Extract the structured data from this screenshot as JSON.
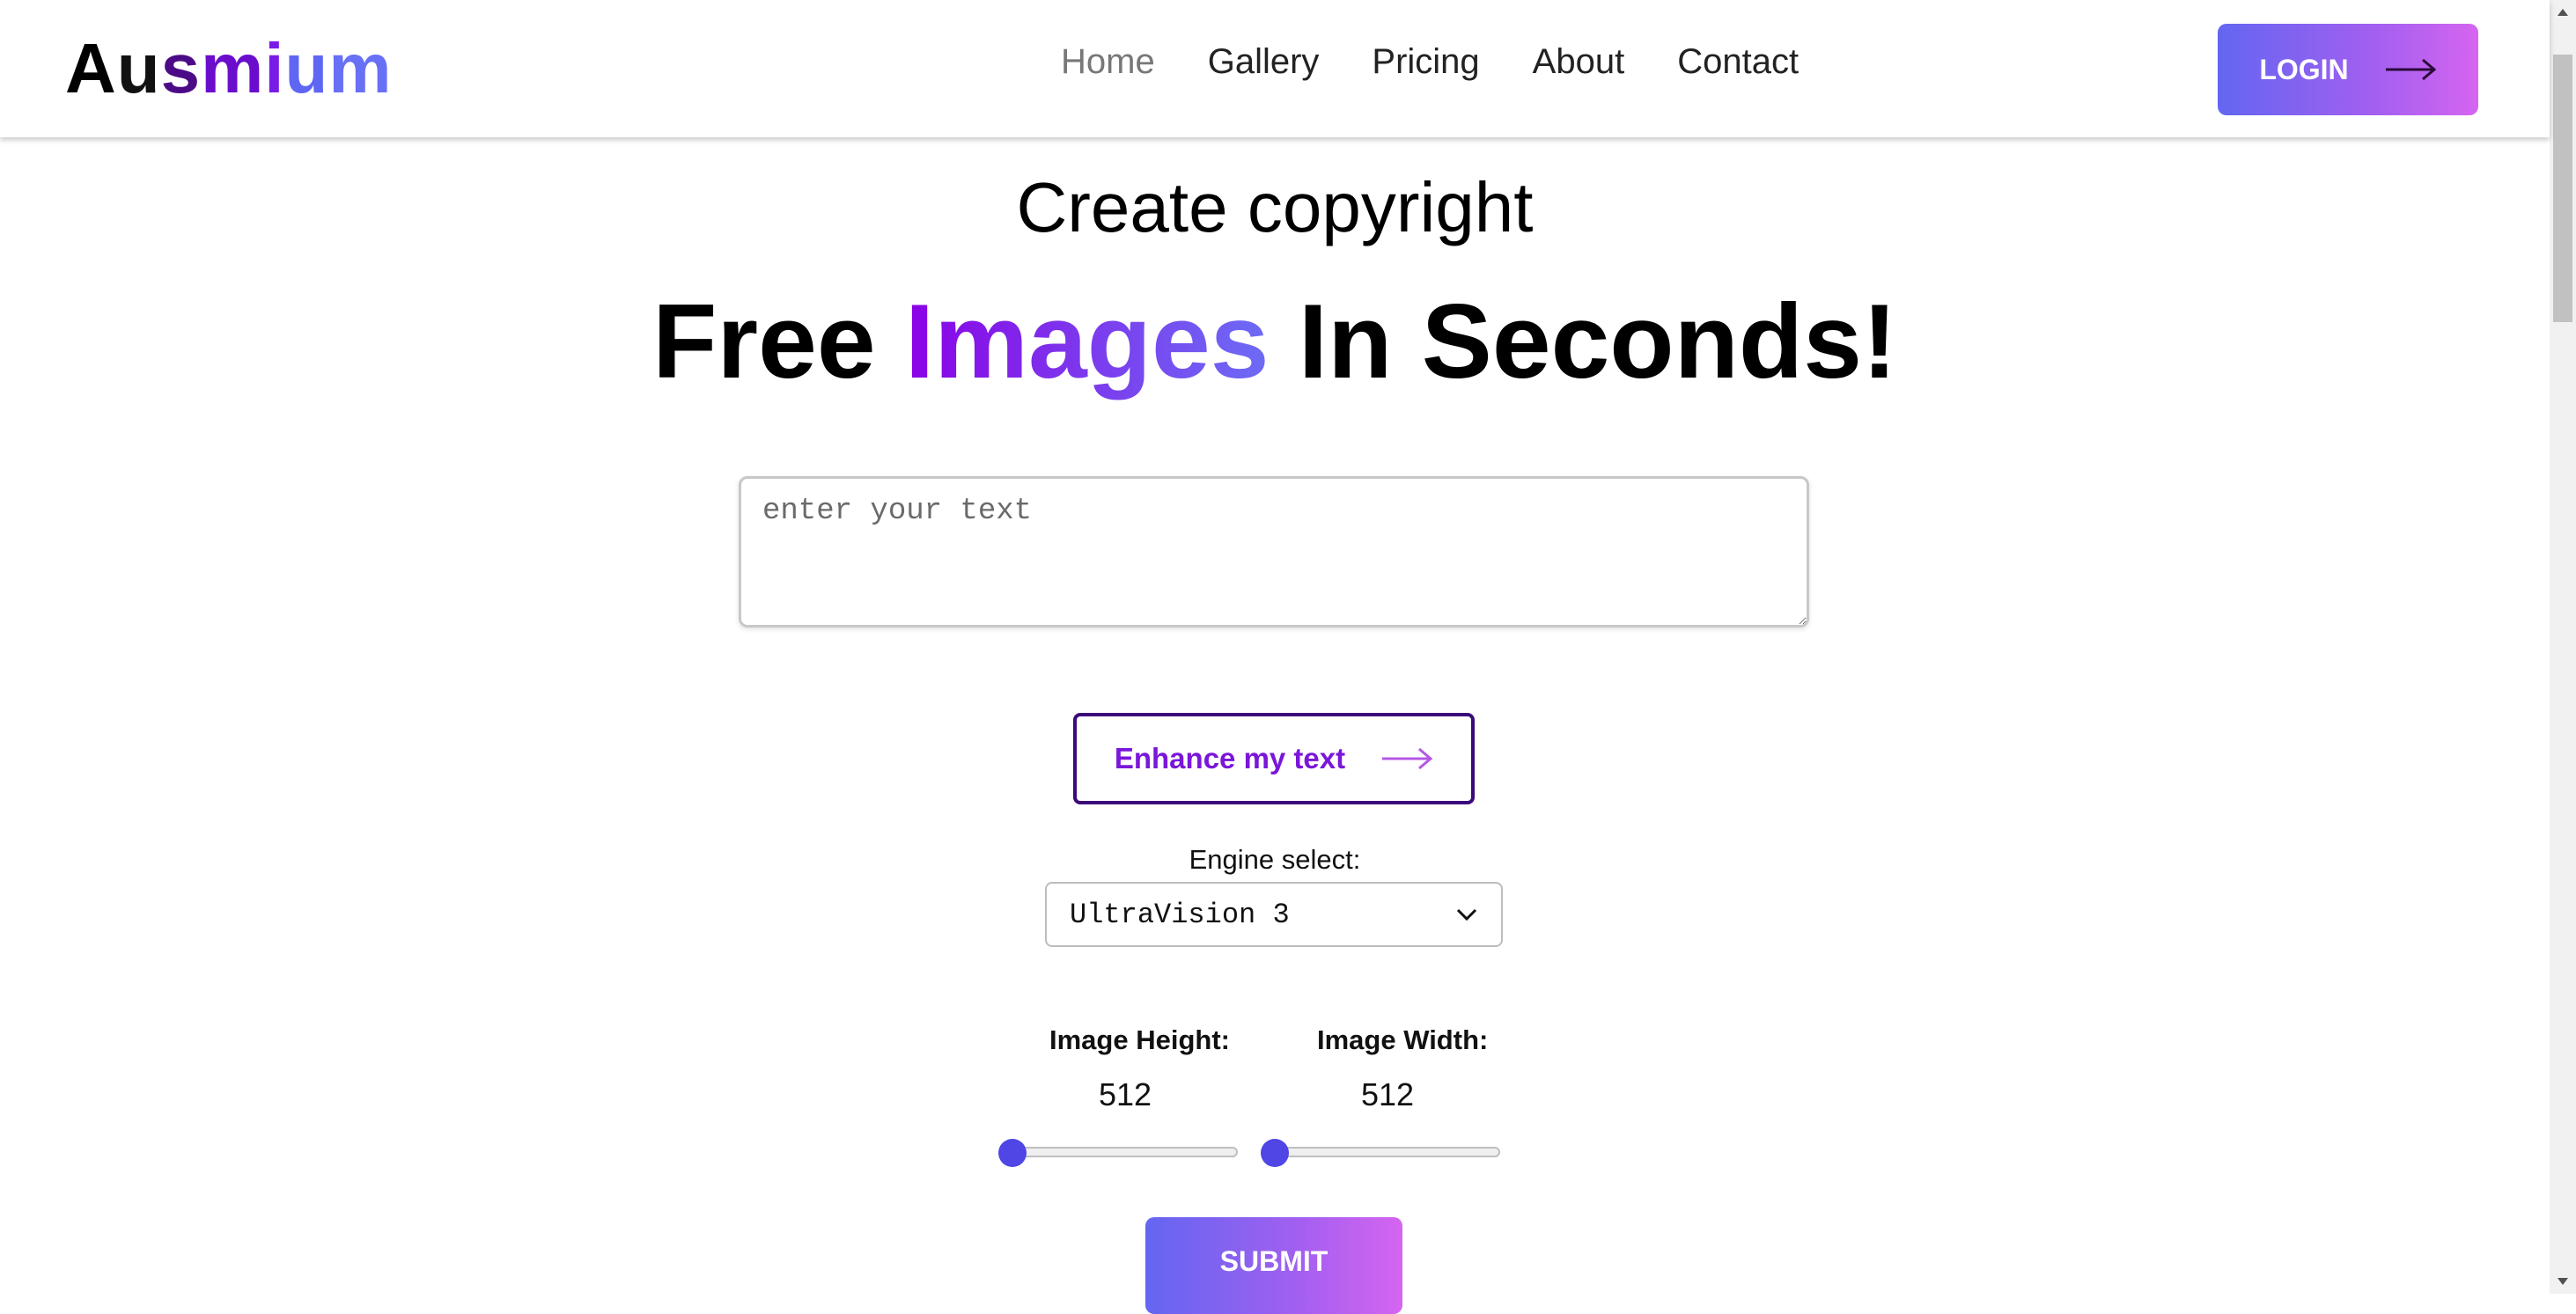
{
  "header": {
    "logo_letters": [
      "A",
      "u",
      "s",
      "m",
      "i",
      "u",
      "m"
    ],
    "logo_colors": [
      "#000000",
      "#111111",
      "#4c0b86",
      "#6a0dcc",
      "#7b1ce6",
      "#5f66f3",
      "#6870f5"
    ],
    "nav": [
      {
        "label": "Home",
        "active": true
      },
      {
        "label": "Gallery",
        "active": false
      },
      {
        "label": "Pricing",
        "active": false
      },
      {
        "label": "About",
        "active": false
      },
      {
        "label": "Contact",
        "active": false
      }
    ],
    "login_label": "LOGIN"
  },
  "hero": {
    "subtitle": "Create copyright",
    "title_before": "Free ",
    "title_highlight": "Images",
    "title_after": " In Seconds!"
  },
  "form": {
    "prompt_placeholder": "enter your text",
    "prompt_value": "",
    "enhance_label": "Enhance my text",
    "engine_label": "Engine select:",
    "engine_selected": "UltraVision 3",
    "height_label": "Image Height:",
    "height_value": "512",
    "height_fraction": 0.0,
    "width_label": "Image Width:",
    "width_value": "512",
    "width_fraction": 0.0,
    "submit_label": "SUBMIT"
  },
  "colors": {
    "accent": "#4f46e5",
    "gradient_start": "#6366f1",
    "gradient_end": "#d565f0",
    "highlight_purple": "#8a00e6",
    "enhance_text": "#7a16d9",
    "enhance_border": "#3b0a7a"
  },
  "icons": {
    "login_arrow": "arrow-right-icon",
    "enhance_arrow": "arrow-right-icon",
    "select_chevron": "chevron-down-icon"
  }
}
